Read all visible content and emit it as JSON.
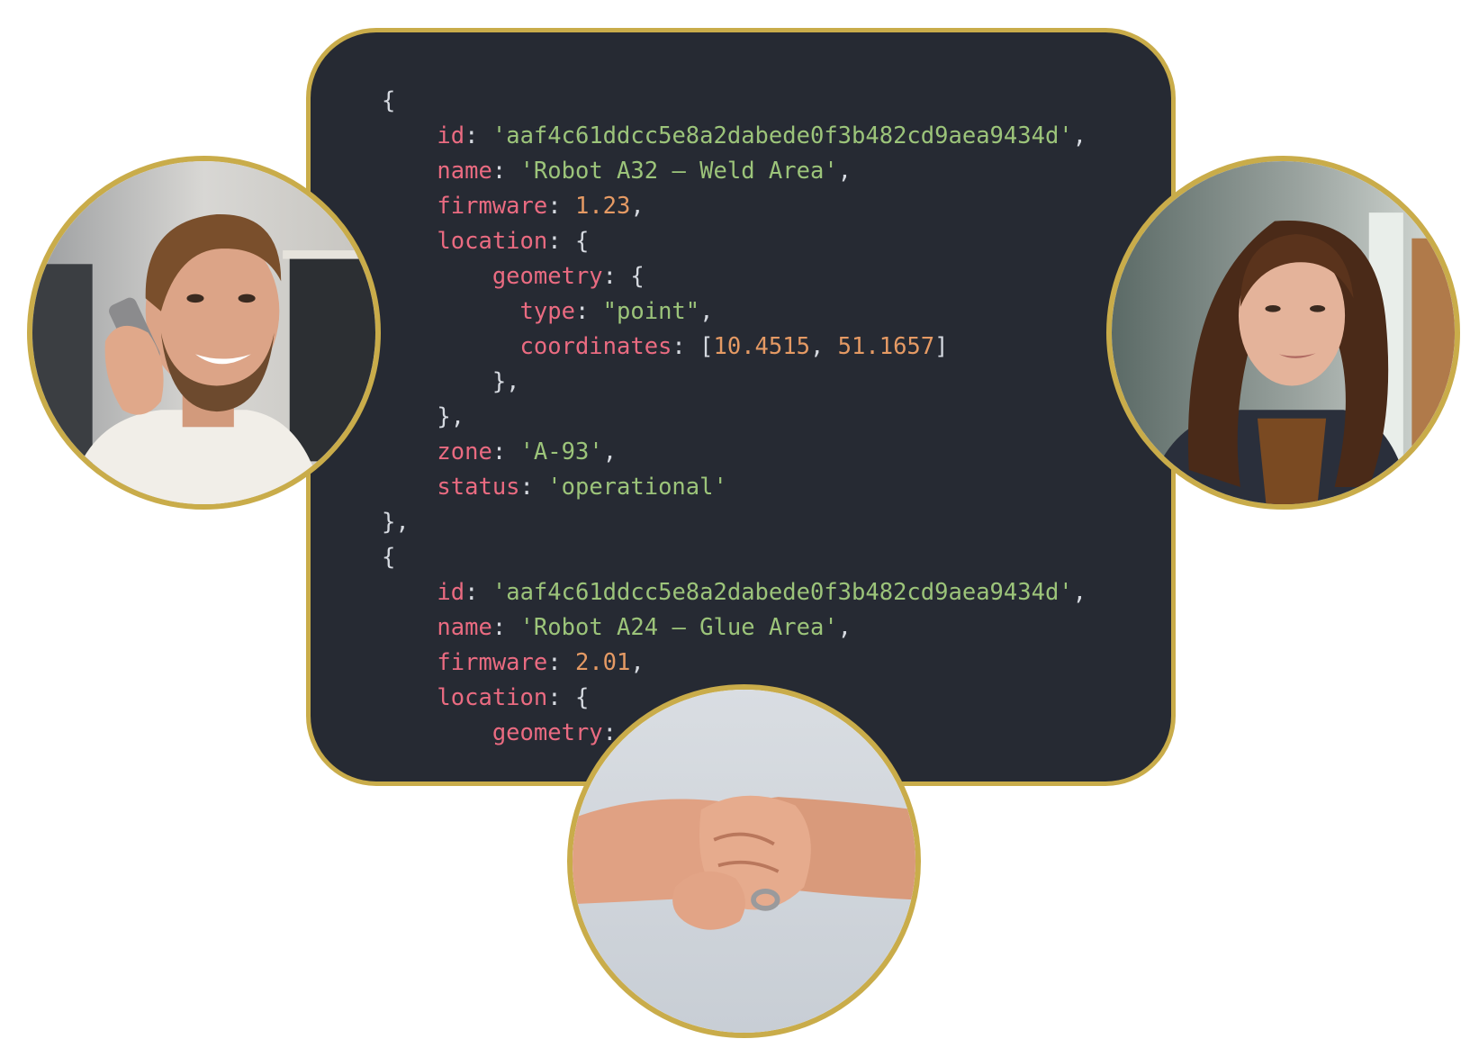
{
  "colors": {
    "background": "#ffffff",
    "card": "#262a33",
    "border_gold": "#c9ac4a",
    "key": "#ea6b81",
    "string": "#9cc47a",
    "number": "#e59a64",
    "punctuation": "#d5d9e0"
  },
  "code": {
    "lines": [
      [
        {
          "t": "punc",
          "v": "{"
        }
      ],
      [
        {
          "t": "punc",
          "v": "    "
        },
        {
          "t": "key",
          "v": "id"
        },
        {
          "t": "punc",
          "v": ": "
        },
        {
          "t": "str",
          "v": "'aaf4c61ddcc5e8a2dabede0f3b482cd9aea9434d'"
        },
        {
          "t": "punc",
          "v": ","
        }
      ],
      [
        {
          "t": "punc",
          "v": "    "
        },
        {
          "t": "key",
          "v": "name"
        },
        {
          "t": "punc",
          "v": ": "
        },
        {
          "t": "str",
          "v": "'Robot A32 – Weld Area'"
        },
        {
          "t": "punc",
          "v": ","
        }
      ],
      [
        {
          "t": "punc",
          "v": "    "
        },
        {
          "t": "key",
          "v": "firmware"
        },
        {
          "t": "punc",
          "v": ": "
        },
        {
          "t": "num",
          "v": "1.23"
        },
        {
          "t": "punc",
          "v": ","
        }
      ],
      [
        {
          "t": "punc",
          "v": "    "
        },
        {
          "t": "key",
          "v": "location"
        },
        {
          "t": "punc",
          "v": ": {"
        }
      ],
      [
        {
          "t": "punc",
          "v": "        "
        },
        {
          "t": "key",
          "v": "geometry"
        },
        {
          "t": "punc",
          "v": ": {"
        }
      ],
      [
        {
          "t": "punc",
          "v": "          "
        },
        {
          "t": "key",
          "v": "type"
        },
        {
          "t": "punc",
          "v": ": "
        },
        {
          "t": "str",
          "v": "\"point\""
        },
        {
          "t": "punc",
          "v": ","
        }
      ],
      [
        {
          "t": "punc",
          "v": "          "
        },
        {
          "t": "key",
          "v": "coordinates"
        },
        {
          "t": "punc",
          "v": ": ["
        },
        {
          "t": "num",
          "v": "10.4515"
        },
        {
          "t": "punc",
          "v": ", "
        },
        {
          "t": "num",
          "v": "51.1657"
        },
        {
          "t": "punc",
          "v": "]"
        }
      ],
      [
        {
          "t": "punc",
          "v": "        },"
        }
      ],
      [
        {
          "t": "punc",
          "v": "    },"
        }
      ],
      [
        {
          "t": "punc",
          "v": "    "
        },
        {
          "t": "key",
          "v": "zone"
        },
        {
          "t": "punc",
          "v": ": "
        },
        {
          "t": "str",
          "v": "'A-93'"
        },
        {
          "t": "punc",
          "v": ","
        }
      ],
      [
        {
          "t": "punc",
          "v": "    "
        },
        {
          "t": "key",
          "v": "status"
        },
        {
          "t": "punc",
          "v": ": "
        },
        {
          "t": "str",
          "v": "'operational'"
        }
      ],
      [
        {
          "t": "punc",
          "v": "},"
        }
      ],
      [
        {
          "t": "punc",
          "v": "{"
        }
      ],
      [
        {
          "t": "punc",
          "v": "    "
        },
        {
          "t": "key",
          "v": "id"
        },
        {
          "t": "punc",
          "v": ": "
        },
        {
          "t": "str",
          "v": "'aaf4c61ddcc5e8a2dabede0f3b482cd9aea9434d'"
        },
        {
          "t": "punc",
          "v": ","
        }
      ],
      [
        {
          "t": "punc",
          "v": "    "
        },
        {
          "t": "key",
          "v": "name"
        },
        {
          "t": "punc",
          "v": ": "
        },
        {
          "t": "str",
          "v": "'Robot A24 – Glue Area'"
        },
        {
          "t": "punc",
          "v": ","
        }
      ],
      [
        {
          "t": "punc",
          "v": "    "
        },
        {
          "t": "key",
          "v": "firmware"
        },
        {
          "t": "punc",
          "v": ": "
        },
        {
          "t": "num",
          "v": "2.01"
        },
        {
          "t": "punc",
          "v": ","
        }
      ],
      [
        {
          "t": "punc",
          "v": "    "
        },
        {
          "t": "key",
          "v": "location"
        },
        {
          "t": "punc",
          "v": ": {"
        }
      ],
      [
        {
          "t": "punc",
          "v": "        "
        },
        {
          "t": "key",
          "v": "geometry"
        },
        {
          "t": "punc",
          "v": ": "
        }
      ]
    ]
  },
  "photos": {
    "left": {
      "subject": "man-on-phone"
    },
    "right": {
      "subject": "woman-portrait"
    },
    "bottom": {
      "subject": "handshake"
    }
  }
}
